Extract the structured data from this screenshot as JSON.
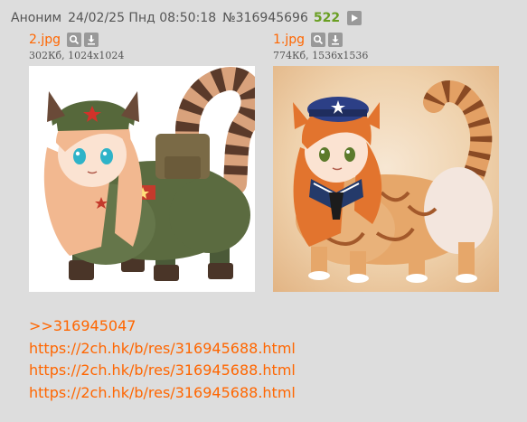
{
  "post": {
    "author": "Аноним",
    "date": "24/02/25 Пнд 08:50:18",
    "number": "№316945696",
    "reply_count": "522"
  },
  "files": [
    {
      "name": "2.jpg",
      "meta": "302Кб, 1024x1024"
    },
    {
      "name": "1.jpg",
      "meta": "774Кб, 1536x1536"
    }
  ],
  "body": {
    "reply_link": ">>316945047",
    "urls": [
      "https://2ch.hk/b/res/316945688.html",
      "https://2ch.hk/b/res/316945688.html",
      "https://2ch.hk/b/res/316945688.html"
    ]
  },
  "icons": {
    "play": "play-icon",
    "search": "search-icon",
    "download": "download-icon"
  },
  "colors": {
    "background": "#dddddd",
    "link": "#ff6600",
    "reply_count": "#6a9f23",
    "icon_bg": "#999999"
  }
}
